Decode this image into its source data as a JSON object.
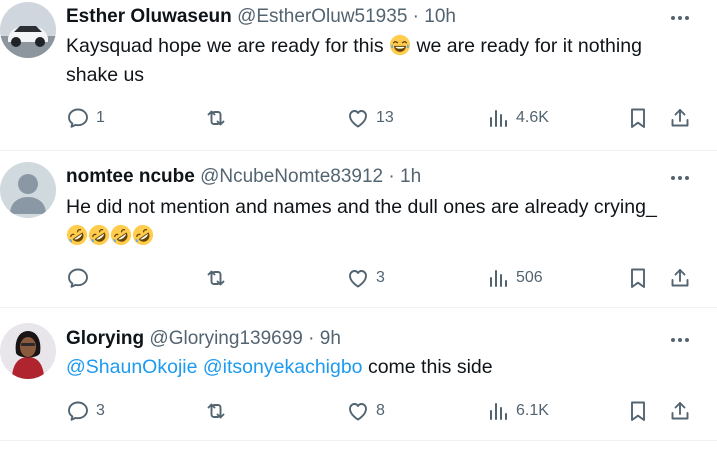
{
  "tweets": [
    {
      "name": "Esther Oluwaseun",
      "handle": "@EstherOluw51935",
      "time": "10h",
      "text_before": "Kaysquad hope we are ready for this ",
      "text_after": " we are ready for it nothing shake us",
      "emoji": "joy-icon",
      "replies": "1",
      "reposts": "",
      "likes": "13",
      "views": "4.6K"
    },
    {
      "name": "nomtee ncube",
      "handle": "@NcubeNomte83912",
      "time": "1h",
      "text": "He did not mention and names and the dull ones are already crying_",
      "emoji": "rofl-icon",
      "replies": "",
      "reposts": "",
      "likes": "3",
      "views": "506"
    },
    {
      "name": "Glorying",
      "handle": "@Glorying139699",
      "time": "9h",
      "mention_1": "@ShaunOkojie",
      "mention_2": "@itsonyekachigbo",
      "text": " come this side",
      "replies": "3",
      "reposts": "",
      "likes": "8",
      "views": "6.1K"
    }
  ],
  "separator": "·",
  "colors": {
    "text": "#0f1419",
    "secondary": "#536471",
    "link": "#1d9bf0",
    "divider": "#eff3f4"
  }
}
